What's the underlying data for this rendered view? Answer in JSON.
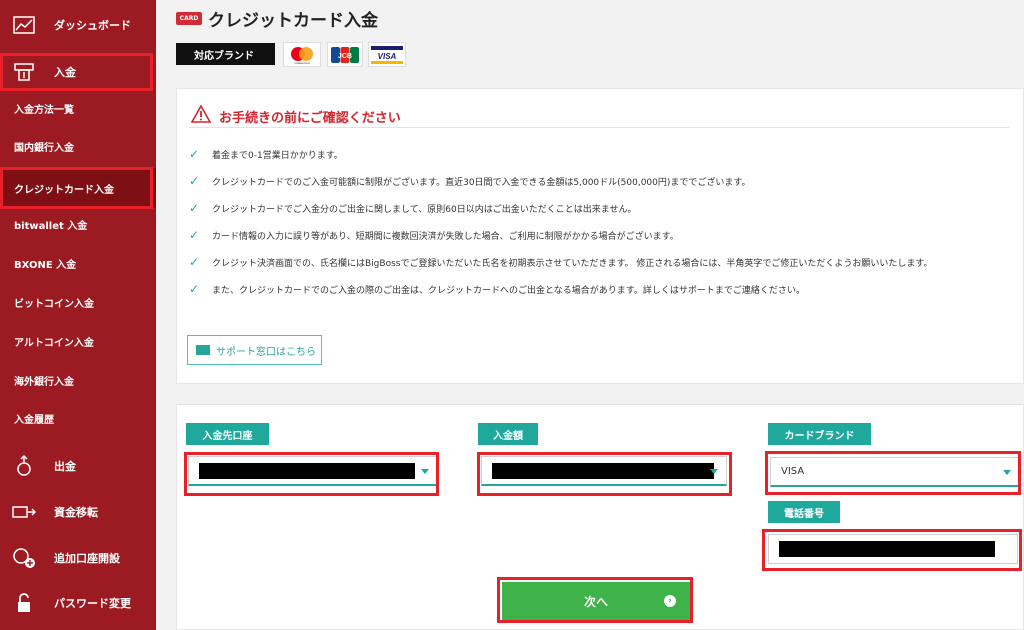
{
  "sidebar": {
    "items": [
      {
        "label": "ダッシュボード",
        "icon": "chart-icon"
      },
      {
        "label": "入金",
        "icon": "deposit-icon"
      },
      {
        "label": "入金方法一覧"
      },
      {
        "label": "国内銀行入金"
      },
      {
        "label": "クレジットカード入金"
      },
      {
        "label": "bitwallet 入金"
      },
      {
        "label": "BXONE 入金"
      },
      {
        "label": "ビットコイン入金"
      },
      {
        "label": "アルトコイン入金"
      },
      {
        "label": "海外銀行入金"
      },
      {
        "label": "入金履歴"
      },
      {
        "label": "出金",
        "icon": "withdraw-icon"
      },
      {
        "label": "資金移転",
        "icon": "transfer-icon"
      },
      {
        "label": "追加口座開設",
        "icon": "add-account-icon"
      },
      {
        "label": "パスワード変更",
        "icon": "lock-icon"
      }
    ]
  },
  "header": {
    "badge": "CARD",
    "title": "クレジットカード入金"
  },
  "brands": {
    "label": "対応ブランド",
    "mastercard_text": "mastercard",
    "jcb": "JCB",
    "visa": "VISA"
  },
  "notice": {
    "title": "お手続きの前にご確認ください",
    "items": [
      "着金まで0-1営業日かかります。",
      "クレジットカードでのご入金可能額に制限がございます。直近30日間で入金できる金額は5,000ドル(500,000円)まででございます。",
      "クレジットカードでご入金分のご出金に関しまして、原則60日以内はご出金いただくことは出来ません。",
      "カード情報の入力に誤り等があり、短期間に複数回決済が失敗した場合、ご利用に制限がかかる場合がございます。",
      "クレジット決済画面での、氏名欄にはBigBossでご登録いただいた氏名を初期表示させていただきます。 修正される場合には、半角英字でご修正いただくようお願いいたします。",
      "また、クレジットカードでのご入金の際のご出金は、クレジットカードへのご出金となる場合があります。詳しくはサポートまでご連絡ください。"
    ],
    "support_label": "サポート窓口はこちら"
  },
  "form": {
    "account_label": "入金先口座",
    "amount_label": "入金額",
    "brand_label": "カードブランド",
    "brand_value": "VISA",
    "phone_label": "電話番号",
    "next_label": "次へ"
  },
  "colors": {
    "sidebar": "#9c1b22",
    "accent": "#1fa99c",
    "next": "#3db34a",
    "warning": "#d0262e",
    "highlight": "#e8202a"
  }
}
